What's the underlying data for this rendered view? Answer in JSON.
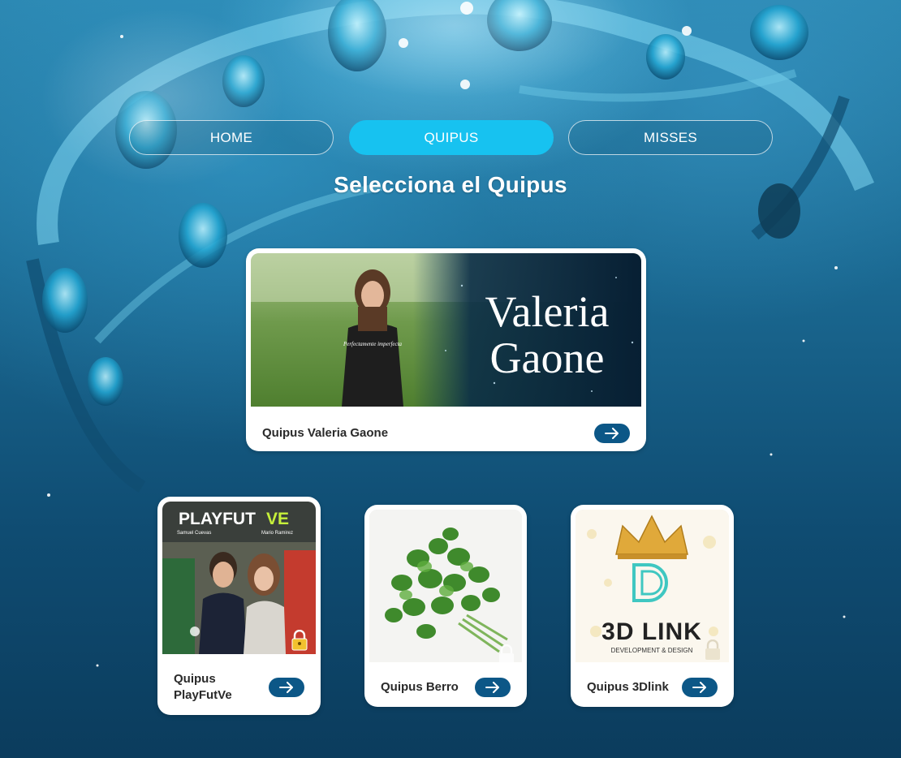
{
  "nav": {
    "items": [
      {
        "label": "HOME",
        "active": false
      },
      {
        "label": "QUIPUS",
        "active": true
      },
      {
        "label": "MISSES",
        "active": false
      }
    ]
  },
  "page": {
    "title": "Selecciona el Quipus"
  },
  "featured": {
    "label": "Quipus Valeria Gaone",
    "banner_text_line1": "Valeria",
    "banner_text_line2": "Gaone",
    "shirt_text": "Perfectamente imperfecta"
  },
  "cards": [
    {
      "label_line1": "Quipus",
      "label_line2": "PlayFutVe",
      "logo_text_a": "PLAYFUT",
      "logo_text_b": "VE",
      "logo_sub_left": "Samuel Cuevas",
      "logo_sub_right": "Mario Ramirez",
      "locked": true
    },
    {
      "label": "Quipus Berro",
      "locked": true
    },
    {
      "label": "Quipus 3Dlink",
      "logo_text": "3D LINK",
      "logo_sub": "DEVELOPMENT & DESIGN",
      "locked": true
    }
  ],
  "colors": {
    "accent": "#17c2f0",
    "arrow_button": "#0c5787"
  },
  "icons": [
    "arrow-right-icon",
    "lock-icon",
    "crown-icon"
  ]
}
